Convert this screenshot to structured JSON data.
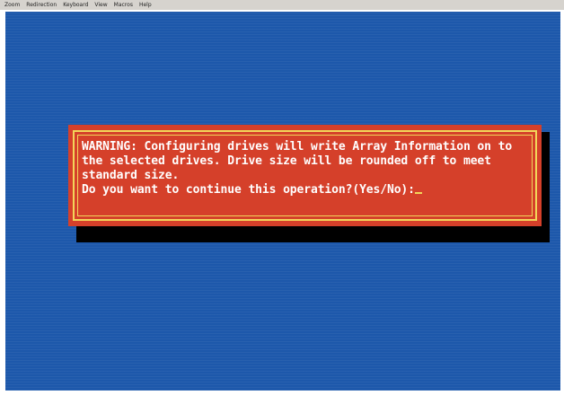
{
  "menubar": {
    "items": [
      "Zoom",
      "Redirection",
      "Keyboard",
      "View",
      "Macros",
      "Help"
    ]
  },
  "dialog": {
    "line1": "WARNING: Configuring drives will write Array Information on to",
    "line2": "the selected drives. Drive size will be rounded off to meet",
    "line3": "standard size.",
    "prompt": "Do you want to continue this operation?(Yes/No):"
  },
  "colors": {
    "console_background": "#1d58ab",
    "dialog_background": "#d5402a",
    "dialog_border": "#f2d55a",
    "dialog_text": "#ffffff"
  }
}
